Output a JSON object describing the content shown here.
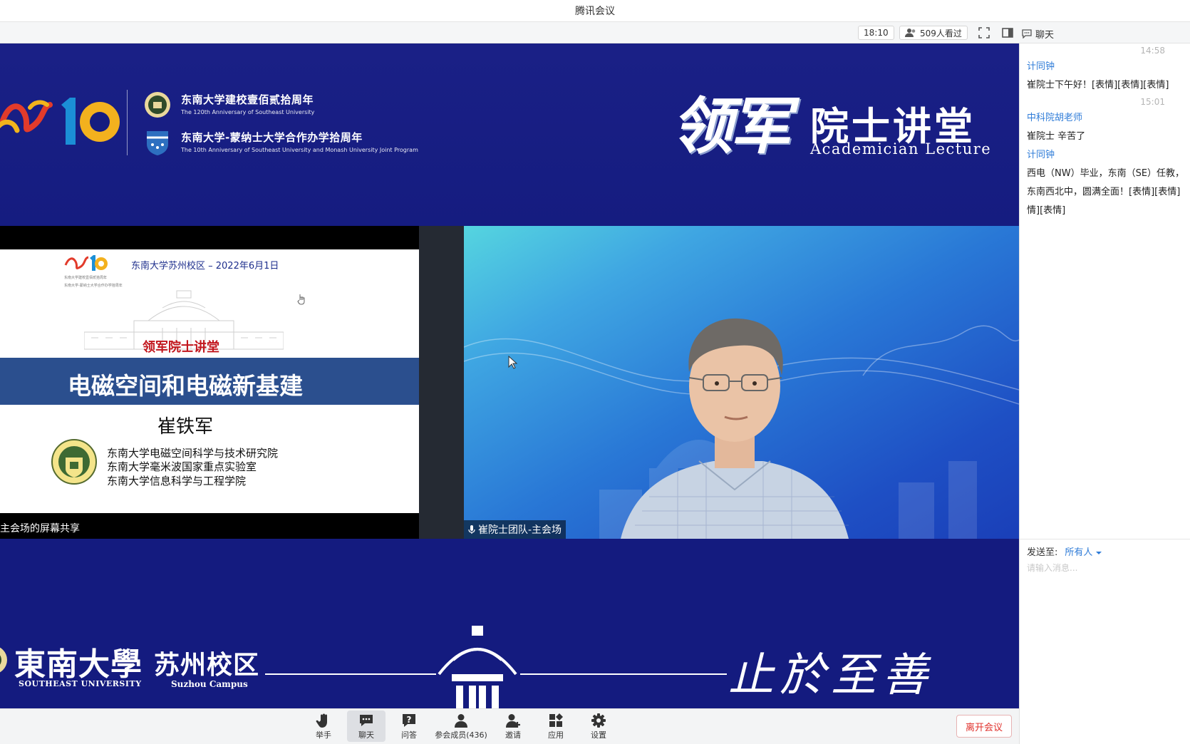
{
  "window": {
    "title": "腾讯会议"
  },
  "toolbar": {
    "timer": "18:10",
    "viewers": "509人看过",
    "chat_title": "聊天"
  },
  "banner": {
    "anniv_cn": "东南大学建校壹佰贰拾周年",
    "anniv_en": "The 120th Anniversary of Southeast University",
    "monash_cn": "东南大学-蒙纳士大学合作办学拾周年",
    "monash_en": "The 10th Anniversary of Southeast University and Monash University Joint Program",
    "lecture_big": "领军",
    "lecture_small": "院士讲堂",
    "lecture_en": "Academician Lecture",
    "ten": "10"
  },
  "slide": {
    "header": "东南大学苏州校区 – 2022年6月1日",
    "tiny1": "东南大学建校壹佰贰拾周年",
    "tiny2": "东南大学-蒙纳士大学合作办学拾周年",
    "subtitle": "领军院士讲堂",
    "title": "电磁空间和电磁新基建",
    "speaker": "崔铁军",
    "org1": "东南大学电磁空间科学与技术研究院",
    "org2": "东南大学毫米波国家重点实验室",
    "org3": "东南大学信息科学与工程学院"
  },
  "share_caption": "主会场的屏幕共享",
  "camera_caption": "崔院士团队-主会场",
  "bottom_banner": {
    "seu_cn": "東南大學",
    "seu_en": "SOUTHEAST UNIVERSITY",
    "suz_cn": "苏州校区",
    "suz_en": "Suzhou Campus",
    "motto": "止於至善"
  },
  "controls": {
    "raise_hand": "举手",
    "chat": "聊天",
    "qa": "问答",
    "members": "参会成员(436)",
    "invite": "邀请",
    "apps": "应用",
    "settings": "设置",
    "leave": "离开会议"
  },
  "chat": {
    "messages": [
      {
        "time": "14:58",
        "sender": "计同钟",
        "lines": [
          "崔院士下午好！[表情][表情][表情]"
        ]
      },
      {
        "time": "15:01",
        "sender": "中科院胡老师",
        "lines": [
          "崔院士 辛苦了"
        ]
      },
      {
        "time": "",
        "sender": "计同钟",
        "lines": [
          "西电（NW）毕业，东南（SE）任教，",
          "东南西北中，圆满全面！[表情][表情]",
          "情][表情]"
        ]
      }
    ],
    "send_to_label": "发送至:",
    "send_to_value": "所有人",
    "input_placeholder": "请输入消息..."
  },
  "colors": {
    "stage_blue": "#141b7f",
    "chat_name": "#2f7cd8",
    "leave_red": "#e0302b"
  }
}
